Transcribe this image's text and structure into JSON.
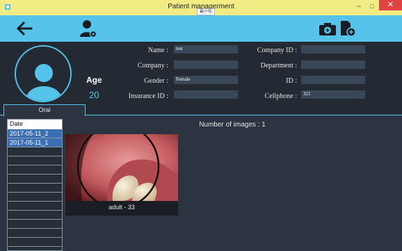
{
  "window": {
    "title": "Patient managerment",
    "tooltip": "最小化",
    "minimize": "–",
    "maximize": "□",
    "close": "✕"
  },
  "toolbar": {
    "back_icon": "arrow-left-icon",
    "patient_icon": "user-settings-icon",
    "camera_icon": "camera-add-icon",
    "document_icon": "document-add-icon"
  },
  "patient": {
    "age_label": "Age",
    "age_value": "20",
    "fields": {
      "name": {
        "label": "Name :",
        "value": "test"
      },
      "company": {
        "label": "Company :",
        "value": ""
      },
      "gender": {
        "label": "Gender :",
        "value": "Female"
      },
      "insurance_id": {
        "label": "Insurance ID :",
        "value": ""
      },
      "company_id": {
        "label": "Company ID :",
        "value": ""
      },
      "department": {
        "label": "Department :",
        "value": ""
      },
      "id": {
        "label": "ID :",
        "value": ""
      },
      "cellphone": {
        "label": "Cellphone :",
        "value": "321"
      }
    }
  },
  "tabs": {
    "oral": "Oral"
  },
  "date_list": {
    "header": "Date",
    "items": [
      "2017-05-11_2",
      "2017-05-11_1"
    ]
  },
  "images": {
    "count_label": "Number of images : 1",
    "items": [
      {
        "caption": "adult - 33"
      }
    ]
  },
  "colors": {
    "accent": "#55c3ea",
    "titlebar": "#f3eb84",
    "panel": "#232a33",
    "background": "#2b3440",
    "selection": "#3b6fb5"
  }
}
